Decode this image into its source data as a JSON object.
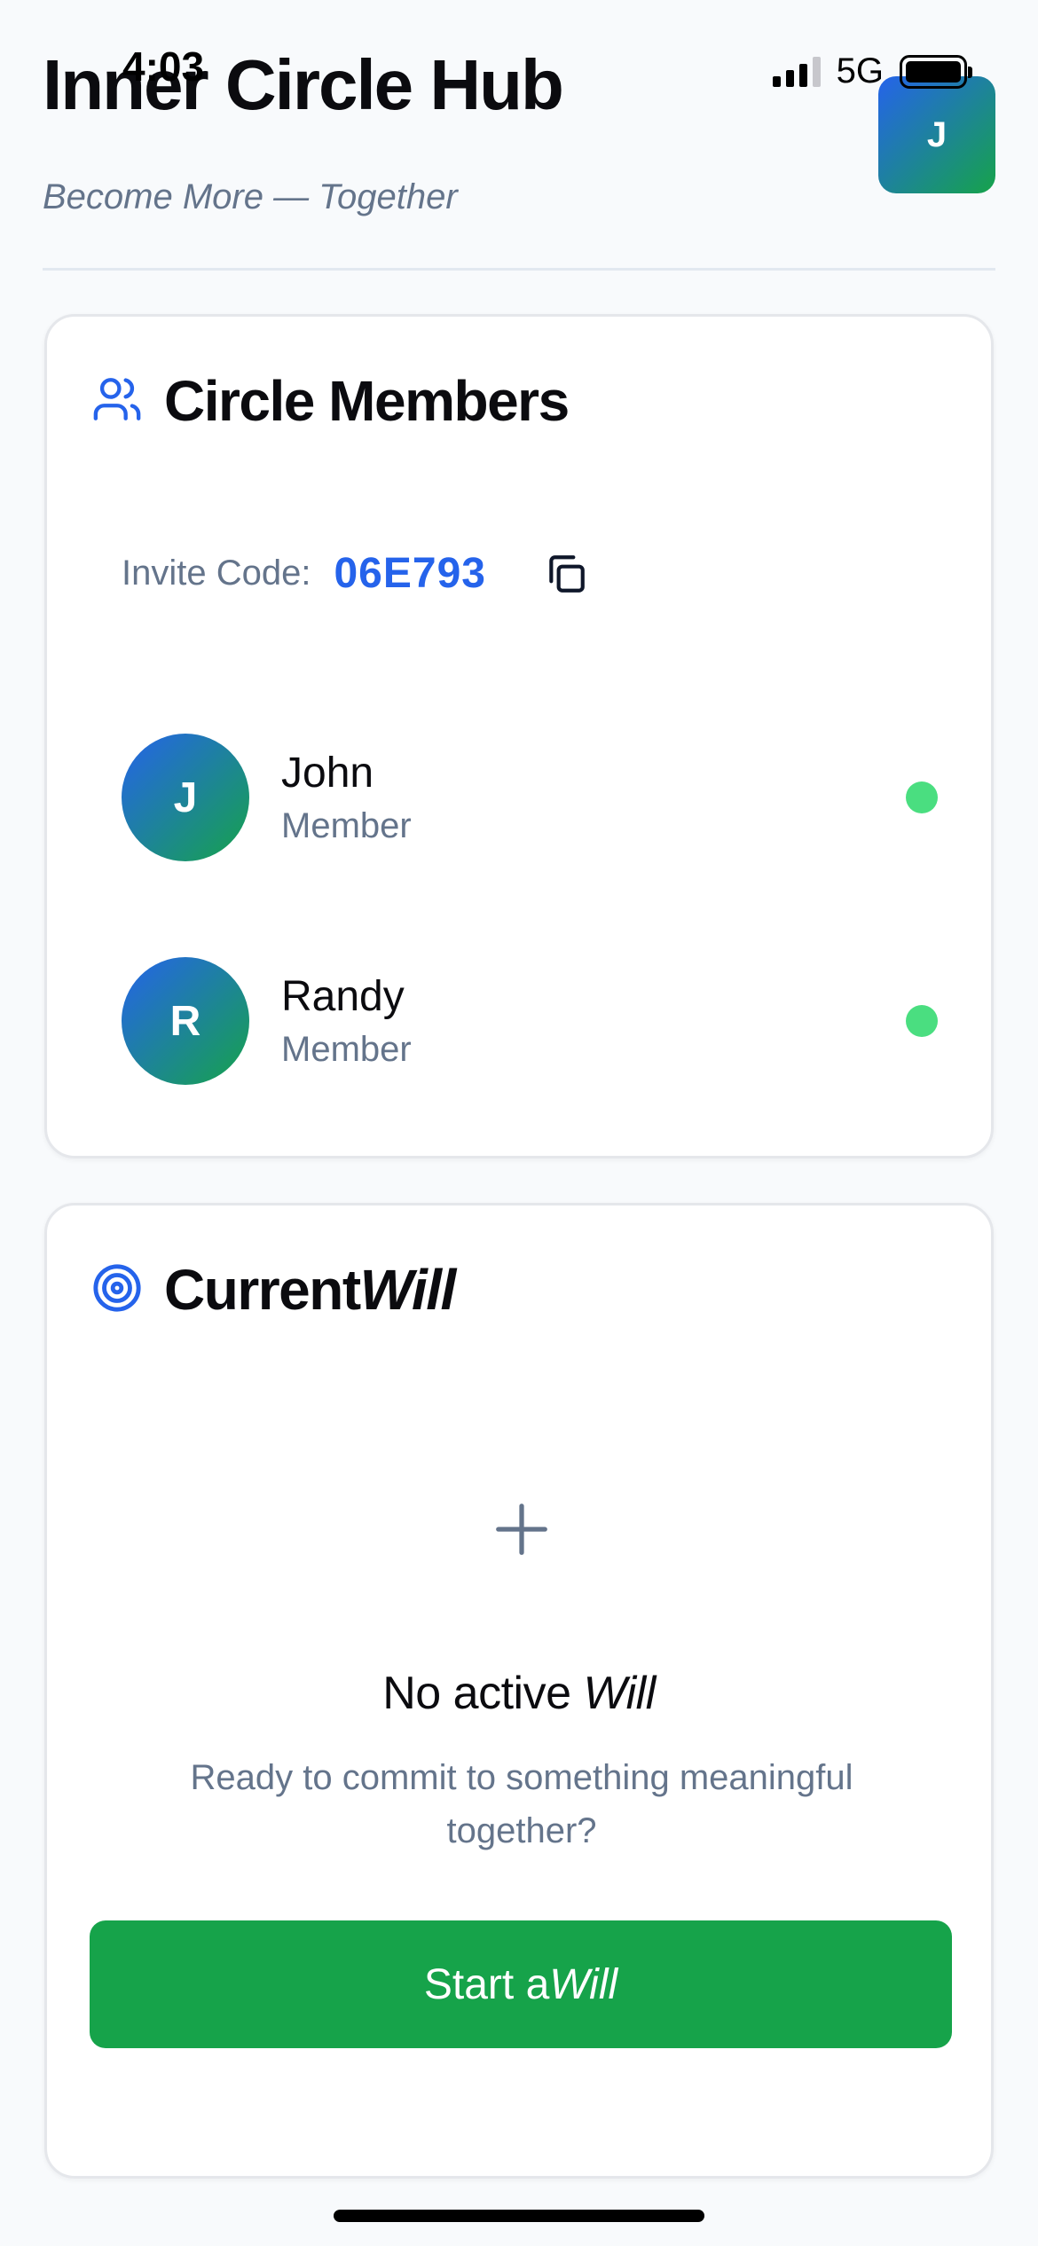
{
  "status_bar": {
    "time": "4:03",
    "network": "5G",
    "signal_bars": 3,
    "battery_icon": "battery-icon"
  },
  "header": {
    "title": "Inner Circle Hub",
    "subtitle": "Become More — Together",
    "profile_initial": "J"
  },
  "members_card": {
    "title": "Circle Members",
    "icon": "users-icon",
    "invite_label": "Invite Code:",
    "invite_code": "06E793",
    "copy_icon": "copy-icon",
    "members": [
      {
        "initial": "J",
        "name": "John",
        "role": "Member",
        "online": true
      },
      {
        "initial": "R",
        "name": "Randy",
        "role": "Member",
        "online": true
      }
    ]
  },
  "will_card": {
    "title_main": "Current",
    "title_italic": "Will",
    "icon": "target-icon",
    "empty_icon": "plus-icon",
    "empty_title_main": "No active ",
    "empty_title_italic": "Will",
    "empty_description": "Ready to commit to something meaningful together?",
    "button_label_main": "Start a",
    "button_label_italic": "Will"
  },
  "colors": {
    "accent_blue": "#2563eb",
    "accent_green": "#16a34a",
    "online_green": "#4ade80",
    "muted_text": "#64748b",
    "background": "#f8fafc"
  }
}
